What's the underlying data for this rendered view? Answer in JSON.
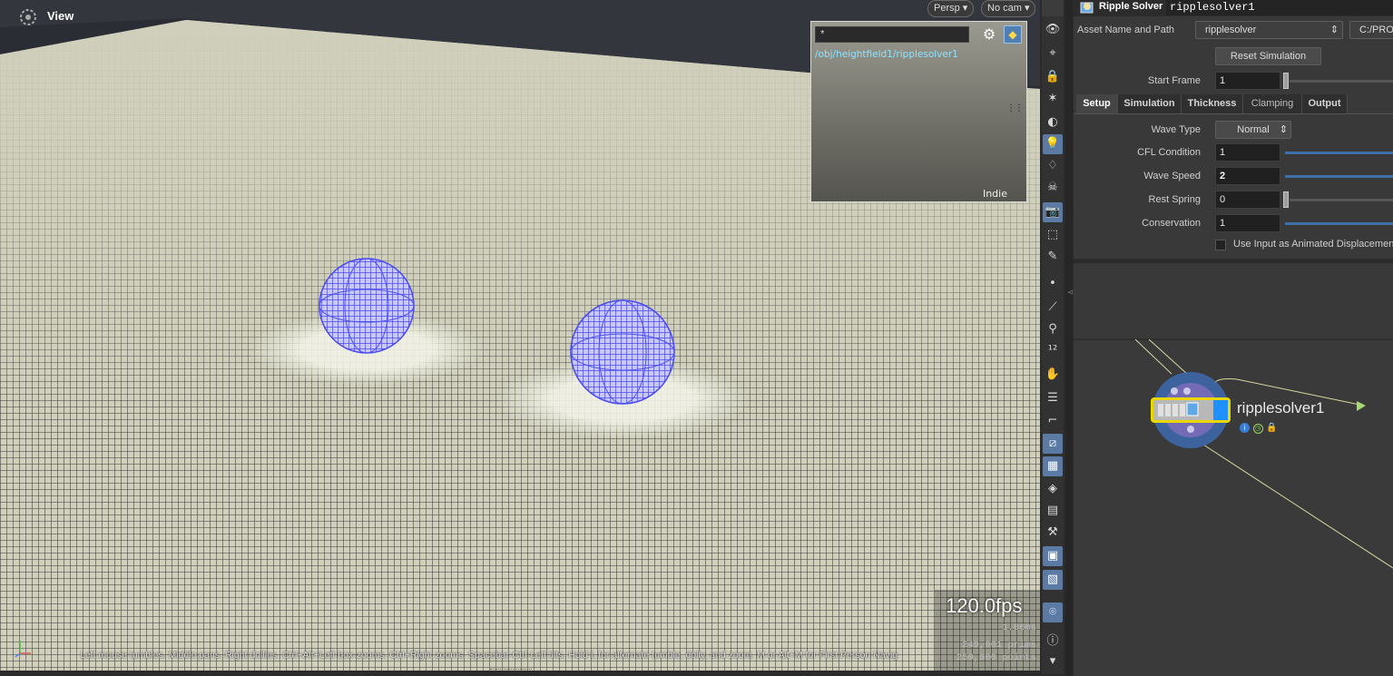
{
  "viewport": {
    "title": "View",
    "persp_label": "Persp ▾",
    "nocam_label": "No cam ▾",
    "fps": "120.0fps",
    "stats": {
      "ms": "1.86ms",
      "prims": "249,001  prims",
      "points": "250,000  points"
    },
    "help_text": "Left mouse tumbles. Middle pans. Right dollies. Ctrl+Alt+Left box-zooms. Ctrl+Right zooms. Spacebar-Ctrl-Left tilts. Hold L for alternate tumble, dolly, and zoom. M or Alt+M for First Person Navig",
    "mini_panel": {
      "filter_value": "*",
      "path": "/obj/heightfield1/ripplesolver1",
      "badge": "Indie"
    },
    "colors": {
      "ground": "#ccccb8",
      "sky": "#2a2d34",
      "sphere": "#5a5af5"
    }
  },
  "toolbar": {
    "icons": [
      "eye-icon",
      "snap-icon",
      "lock-icon",
      "light-icon",
      "shading-icon",
      "bulb-icon",
      "bulb-outline-icon",
      "skull-icon",
      "camera-icon",
      "select-icon",
      "brush-icon",
      "point-icon",
      "edge-icon",
      "pin-icon",
      "number-icon",
      "paint-icon",
      "grab-icon",
      "corner-icon",
      "sculpt-icon",
      "checker-icon",
      "diamond-icon",
      "mesh-icon",
      "tool-icon",
      "box-icon",
      "image-icon",
      "location-icon",
      "info-icon",
      "arrow-down-icon"
    ]
  },
  "params": {
    "node_type": "Ripple Solver",
    "node_name": "ripplesolver1",
    "asset_label": "Asset Name and Path",
    "asset_value": "ripplesolver",
    "asset_path": "C:/PRO",
    "reset_button": "Reset Simulation",
    "start_frame_label": "Start Frame",
    "start_frame_value": "1",
    "tabs": [
      {
        "label": "Setup"
      },
      {
        "label": "Simulation"
      },
      {
        "label": "Thickness"
      },
      {
        "label": "Clamping"
      },
      {
        "label": "Output"
      }
    ],
    "wave_type_label": "Wave Type",
    "wave_type_value": "Normal",
    "cfl_label": "CFL Condition",
    "cfl_value": "1",
    "wave_speed_label": "Wave Speed",
    "wave_speed_value": "2",
    "rest_spring_label": "Rest Spring",
    "rest_spring_value": "0",
    "conservation_label": "Conservation",
    "conservation_value": "1",
    "animated_disp_label": "Use Input as Animated Displacement",
    "animated_disp_checked": false
  },
  "network": {
    "node_label": "ripplesolver1",
    "node_color": "#1e90ff"
  }
}
